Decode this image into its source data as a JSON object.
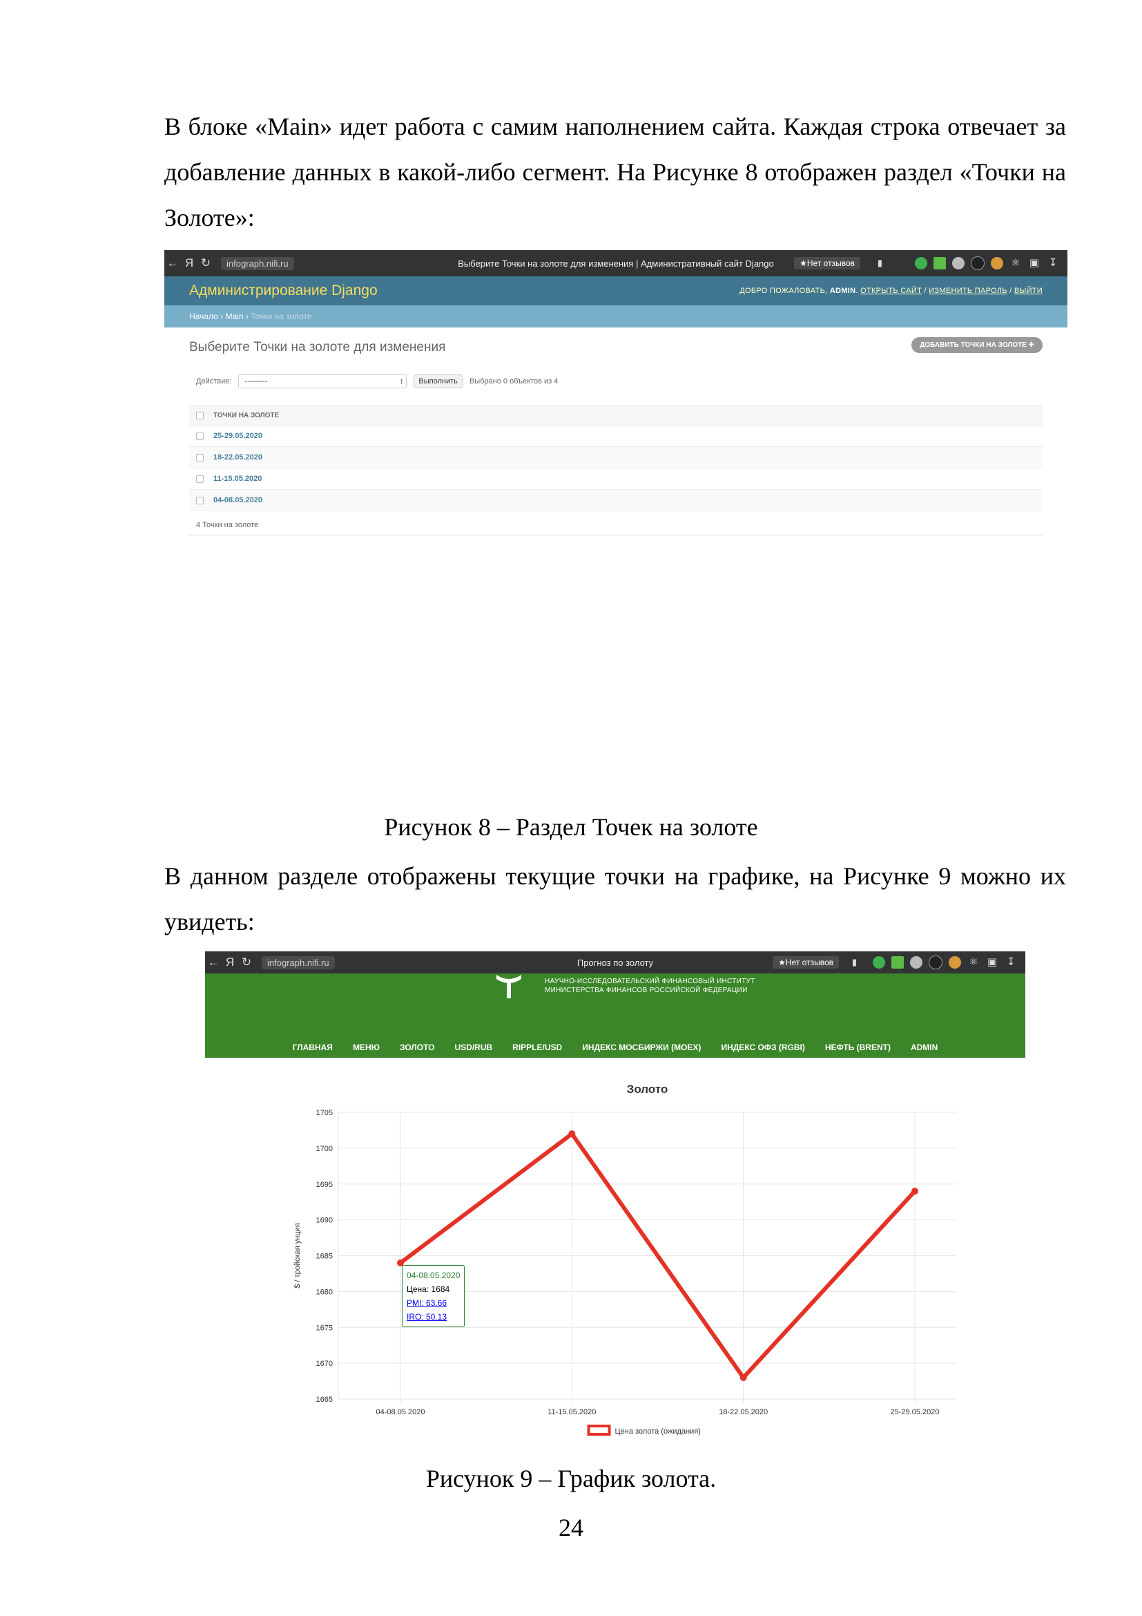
{
  "paragraphs": {
    "p1": "В блоке «Main» идет работа с самим наполнением сайта. Каждая строка отвечает за добавление данных в какой-либо сегмент. На Рисунке 8 отображен раздел «Точки на Золоте»:",
    "p2": "В данном разделе отображены текущие точки на графике, на Рисунке 9 можно их увидеть:"
  },
  "captions": {
    "fig8": "Рисунок 8 – Раздел Точек на золоте",
    "fig9": "Рисунок 9 – График золота."
  },
  "page_number": "24",
  "figure8": {
    "browser": {
      "url": "infograph.nifi.ru",
      "tab_title": "Выберите Точки на золоте для изменения | Административный сайт Django",
      "reviews": "★Нет отзывов"
    },
    "header": {
      "branding": "Администрирование Django",
      "welcome": "Добро пожаловать,",
      "user": "ADMIN",
      "links": [
        "Открыть сайт",
        "Изменить пароль",
        "Выйти"
      ]
    },
    "breadcrumbs": {
      "home": "Начало",
      "app": "Main",
      "current": "Точки на золоте"
    },
    "content": {
      "title": "Выберите Точки на золоте для изменения",
      "add_button": "Добавить Точки на золоте",
      "action_label": "Действие:",
      "action_value": "---------",
      "go_button": "Выполнить",
      "selected_text": "Выбрано 0 объектов из 4",
      "column_header": "Точки на золоте",
      "rows": [
        "25-29.05.2020",
        "18-22.05.2020",
        "11-15.05.2020",
        "04-08.05.2020"
      ],
      "count_text": "4 Точки на золоте"
    }
  },
  "figure9": {
    "browser": {
      "url": "infograph.nifi.ru",
      "tab_title": "Прогноз по золоту",
      "reviews": "★Нет отзывов"
    },
    "header": {
      "org_line1": "НАУЧНО-ИССЛЕДОВАТЕЛЬСКИЙ ФИНАНСОВЫЙ ИНСТИТУТ",
      "org_line2": "МИНИСТЕРСТВА ФИНАНСОВ РОССИЙСКОЙ ФЕДЕРАЦИИ",
      "menu": [
        "Главная",
        "Меню",
        "Золото",
        "USD/RUB",
        "RIPPLE/USD",
        "Индекс Мосбиржи (MOEX)",
        "Индекс ОФЗ (RGBI)",
        "Нефть (BRENT)",
        "ADMIN"
      ]
    },
    "tooltip": {
      "title": "04-08.05.2020",
      "price": "Цена: 1684",
      "pmi": "PMI: 63.66",
      "iro": "IRO: 50.13"
    }
  },
  "chart_data": {
    "type": "line",
    "title": "Золото",
    "ylabel": "$ / тройская унция",
    "xlabel": "",
    "categories": [
      "04-08.05.2020",
      "11-15.05.2020",
      "18-22.05.2020",
      "25-29.05.2020"
    ],
    "series": [
      {
        "name": "Цена золота (ожидания)",
        "values": [
          1684,
          1702,
          1668,
          1694
        ],
        "color": "#e53226"
      }
    ],
    "ylim": [
      1665,
      1705
    ],
    "yticks": [
      1665,
      1670,
      1675,
      1680,
      1685,
      1690,
      1695,
      1700,
      1705
    ],
    "grid": true,
    "legend": "bottom"
  },
  "colors": {
    "django_header": "#417690",
    "django_breadcrumbs": "#79aec8",
    "django_branding": "#f5dd5d",
    "site_green": "#3b8628",
    "line_red": "#e53226"
  }
}
